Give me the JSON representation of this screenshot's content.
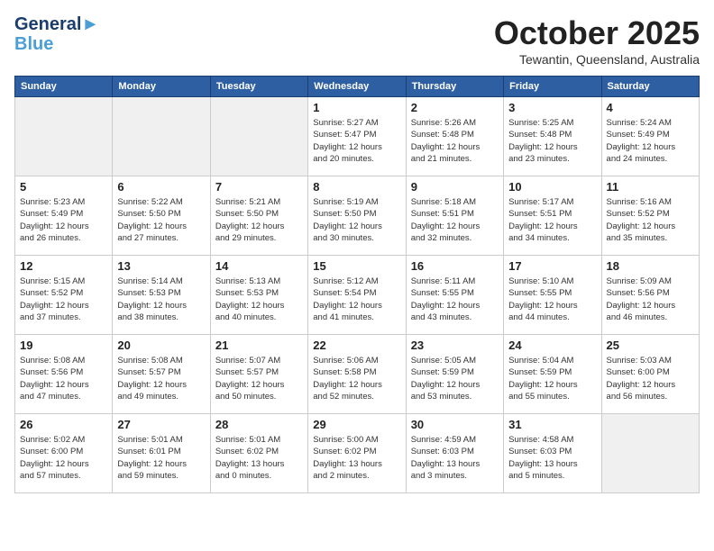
{
  "logo": {
    "line1": "General",
    "line2": "Blue"
  },
  "title": "October 2025",
  "subtitle": "Tewantin, Queensland, Australia",
  "days_of_week": [
    "Sunday",
    "Monday",
    "Tuesday",
    "Wednesday",
    "Thursday",
    "Friday",
    "Saturday"
  ],
  "weeks": [
    [
      {
        "day": "",
        "info": ""
      },
      {
        "day": "",
        "info": ""
      },
      {
        "day": "",
        "info": ""
      },
      {
        "day": "1",
        "info": "Sunrise: 5:27 AM\nSunset: 5:47 PM\nDaylight: 12 hours\nand 20 minutes."
      },
      {
        "day": "2",
        "info": "Sunrise: 5:26 AM\nSunset: 5:48 PM\nDaylight: 12 hours\nand 21 minutes."
      },
      {
        "day": "3",
        "info": "Sunrise: 5:25 AM\nSunset: 5:48 PM\nDaylight: 12 hours\nand 23 minutes."
      },
      {
        "day": "4",
        "info": "Sunrise: 5:24 AM\nSunset: 5:49 PM\nDaylight: 12 hours\nand 24 minutes."
      }
    ],
    [
      {
        "day": "5",
        "info": "Sunrise: 5:23 AM\nSunset: 5:49 PM\nDaylight: 12 hours\nand 26 minutes."
      },
      {
        "day": "6",
        "info": "Sunrise: 5:22 AM\nSunset: 5:50 PM\nDaylight: 12 hours\nand 27 minutes."
      },
      {
        "day": "7",
        "info": "Sunrise: 5:21 AM\nSunset: 5:50 PM\nDaylight: 12 hours\nand 29 minutes."
      },
      {
        "day": "8",
        "info": "Sunrise: 5:19 AM\nSunset: 5:50 PM\nDaylight: 12 hours\nand 30 minutes."
      },
      {
        "day": "9",
        "info": "Sunrise: 5:18 AM\nSunset: 5:51 PM\nDaylight: 12 hours\nand 32 minutes."
      },
      {
        "day": "10",
        "info": "Sunrise: 5:17 AM\nSunset: 5:51 PM\nDaylight: 12 hours\nand 34 minutes."
      },
      {
        "day": "11",
        "info": "Sunrise: 5:16 AM\nSunset: 5:52 PM\nDaylight: 12 hours\nand 35 minutes."
      }
    ],
    [
      {
        "day": "12",
        "info": "Sunrise: 5:15 AM\nSunset: 5:52 PM\nDaylight: 12 hours\nand 37 minutes."
      },
      {
        "day": "13",
        "info": "Sunrise: 5:14 AM\nSunset: 5:53 PM\nDaylight: 12 hours\nand 38 minutes."
      },
      {
        "day": "14",
        "info": "Sunrise: 5:13 AM\nSunset: 5:53 PM\nDaylight: 12 hours\nand 40 minutes."
      },
      {
        "day": "15",
        "info": "Sunrise: 5:12 AM\nSunset: 5:54 PM\nDaylight: 12 hours\nand 41 minutes."
      },
      {
        "day": "16",
        "info": "Sunrise: 5:11 AM\nSunset: 5:55 PM\nDaylight: 12 hours\nand 43 minutes."
      },
      {
        "day": "17",
        "info": "Sunrise: 5:10 AM\nSunset: 5:55 PM\nDaylight: 12 hours\nand 44 minutes."
      },
      {
        "day": "18",
        "info": "Sunrise: 5:09 AM\nSunset: 5:56 PM\nDaylight: 12 hours\nand 46 minutes."
      }
    ],
    [
      {
        "day": "19",
        "info": "Sunrise: 5:08 AM\nSunset: 5:56 PM\nDaylight: 12 hours\nand 47 minutes."
      },
      {
        "day": "20",
        "info": "Sunrise: 5:08 AM\nSunset: 5:57 PM\nDaylight: 12 hours\nand 49 minutes."
      },
      {
        "day": "21",
        "info": "Sunrise: 5:07 AM\nSunset: 5:57 PM\nDaylight: 12 hours\nand 50 minutes."
      },
      {
        "day": "22",
        "info": "Sunrise: 5:06 AM\nSunset: 5:58 PM\nDaylight: 12 hours\nand 52 minutes."
      },
      {
        "day": "23",
        "info": "Sunrise: 5:05 AM\nSunset: 5:59 PM\nDaylight: 12 hours\nand 53 minutes."
      },
      {
        "day": "24",
        "info": "Sunrise: 5:04 AM\nSunset: 5:59 PM\nDaylight: 12 hours\nand 55 minutes."
      },
      {
        "day": "25",
        "info": "Sunrise: 5:03 AM\nSunset: 6:00 PM\nDaylight: 12 hours\nand 56 minutes."
      }
    ],
    [
      {
        "day": "26",
        "info": "Sunrise: 5:02 AM\nSunset: 6:00 PM\nDaylight: 12 hours\nand 57 minutes."
      },
      {
        "day": "27",
        "info": "Sunrise: 5:01 AM\nSunset: 6:01 PM\nDaylight: 12 hours\nand 59 minutes."
      },
      {
        "day": "28",
        "info": "Sunrise: 5:01 AM\nSunset: 6:02 PM\nDaylight: 13 hours\nand 0 minutes."
      },
      {
        "day": "29",
        "info": "Sunrise: 5:00 AM\nSunset: 6:02 PM\nDaylight: 13 hours\nand 2 minutes."
      },
      {
        "day": "30",
        "info": "Sunrise: 4:59 AM\nSunset: 6:03 PM\nDaylight: 13 hours\nand 3 minutes."
      },
      {
        "day": "31",
        "info": "Sunrise: 4:58 AM\nSunset: 6:03 PM\nDaylight: 13 hours\nand 5 minutes."
      },
      {
        "day": "",
        "info": ""
      }
    ]
  ]
}
